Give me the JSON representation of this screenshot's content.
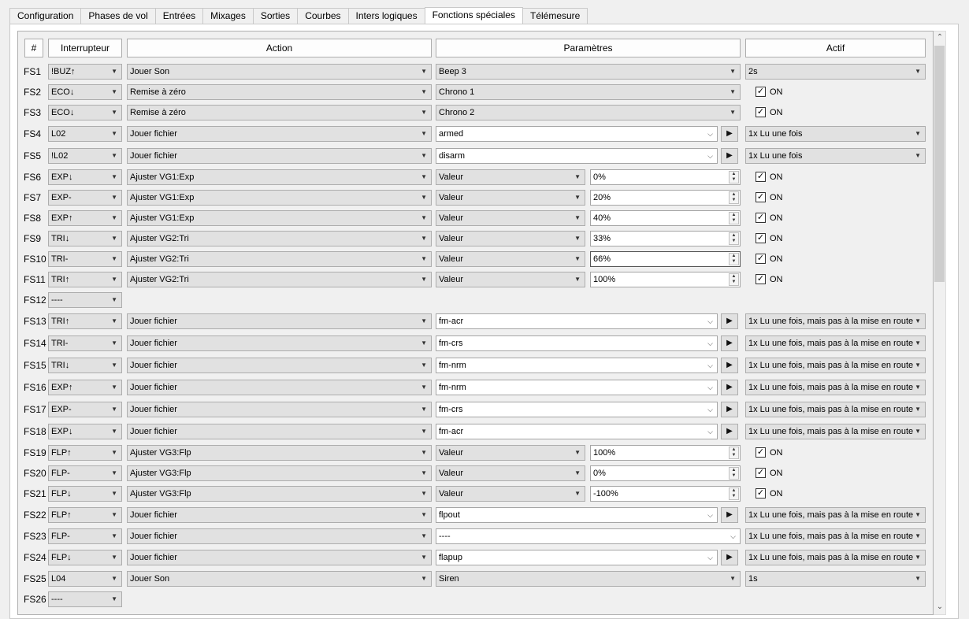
{
  "tabs": [
    "Configuration",
    "Phases de vol",
    "Entrées",
    "Mixages",
    "Sorties",
    "Courbes",
    "Inters logiques",
    "Fonctions spéciales",
    "Télémesure"
  ],
  "active_tab": "Fonctions spéciales",
  "headers": {
    "num": "#",
    "switch": "Interrupteur",
    "action": "Action",
    "params": "Paramètres",
    "active": "Actif"
  },
  "on_label": "ON",
  "rows": [
    {
      "id": "FS1",
      "sw": "!BUZ↑",
      "action": "Jouer Son",
      "kind": "combo",
      "param": "Beep 3",
      "active_type": "combo",
      "active": "2s"
    },
    {
      "id": "FS2",
      "sw": "ECO↓",
      "action": "Remise à zéro",
      "kind": "combo",
      "param": "Chrono 1",
      "active_type": "check",
      "checked": true
    },
    {
      "id": "FS3",
      "sw": "ECO↓",
      "action": "Remise à zéro",
      "kind": "combo",
      "param": "Chrono 2",
      "active_type": "check",
      "checked": true
    },
    {
      "id": "FS4",
      "sw": "L02",
      "action": "Jouer fichier",
      "kind": "file",
      "param": "armed",
      "play": true,
      "active_type": "combo",
      "active": "1x Lu une fois"
    },
    {
      "id": "FS5",
      "sw": "!L02",
      "action": "Jouer fichier",
      "kind": "file",
      "param": "disarm",
      "play": true,
      "active_type": "combo",
      "active": "1x Lu une fois"
    },
    {
      "id": "FS6",
      "sw": "EXP↓",
      "action": "Ajuster VG1:Exp",
      "kind": "value",
      "param": "Valeur",
      "value": "0%",
      "active_type": "check",
      "checked": true
    },
    {
      "id": "FS7",
      "sw": "EXP-",
      "action": "Ajuster VG1:Exp",
      "kind": "value",
      "param": "Valeur",
      "value": "20%",
      "active_type": "check",
      "checked": true
    },
    {
      "id": "FS8",
      "sw": "EXP↑",
      "action": "Ajuster VG1:Exp",
      "kind": "value",
      "param": "Valeur",
      "value": "40%",
      "active_type": "check",
      "checked": true
    },
    {
      "id": "FS9",
      "sw": "TRI↓",
      "action": "Ajuster VG2:Tri",
      "kind": "value",
      "param": "Valeur",
      "value": "33%",
      "active_type": "check",
      "checked": true
    },
    {
      "id": "FS10",
      "sw": "TRI-",
      "action": "Ajuster VG2:Tri",
      "kind": "value",
      "param": "Valeur",
      "value": "66%",
      "focus": true,
      "active_type": "check",
      "checked": true
    },
    {
      "id": "FS11",
      "sw": "TRI↑",
      "action": "Ajuster VG2:Tri",
      "kind": "value",
      "param": "Valeur",
      "value": "100%",
      "active_type": "check",
      "checked": true
    },
    {
      "id": "FS12",
      "sw": "----",
      "kind": "empty"
    },
    {
      "id": "FS13",
      "sw": "TRI↑",
      "action": "Jouer fichier",
      "kind": "file",
      "param": "fm-acr",
      "play": true,
      "active_type": "combo",
      "active": "1x Lu une fois, mais pas à la mise en route"
    },
    {
      "id": "FS14",
      "sw": "TRI-",
      "action": "Jouer fichier",
      "kind": "file",
      "param": "fm-crs",
      "play": true,
      "active_type": "combo",
      "active": "1x Lu une fois, mais pas à la mise en route"
    },
    {
      "id": "FS15",
      "sw": "TRI↓",
      "action": "Jouer fichier",
      "kind": "file",
      "param": "fm-nrm",
      "play": true,
      "active_type": "combo",
      "active": "1x Lu une fois, mais pas à la mise en route"
    },
    {
      "id": "FS16",
      "sw": "EXP↑",
      "action": "Jouer fichier",
      "kind": "file",
      "param": "fm-nrm",
      "play": true,
      "active_type": "combo",
      "active": "1x Lu une fois, mais pas à la mise en route"
    },
    {
      "id": "FS17",
      "sw": "EXP-",
      "action": "Jouer fichier",
      "kind": "file",
      "param": "fm-crs",
      "play": true,
      "active_type": "combo",
      "active": "1x Lu une fois, mais pas à la mise en route"
    },
    {
      "id": "FS18",
      "sw": "EXP↓",
      "action": "Jouer fichier",
      "kind": "file",
      "param": "fm-acr",
      "play": true,
      "active_type": "combo",
      "active": "1x Lu une fois, mais pas à la mise en route"
    },
    {
      "id": "FS19",
      "sw": "FLP↑",
      "action": "Ajuster VG3:Flp",
      "kind": "value",
      "param": "Valeur",
      "value": "100%",
      "active_type": "check",
      "checked": true
    },
    {
      "id": "FS20",
      "sw": "FLP-",
      "action": "Ajuster VG3:Flp",
      "kind": "value",
      "param": "Valeur",
      "value": "0%",
      "active_type": "check",
      "checked": true
    },
    {
      "id": "FS21",
      "sw": "FLP↓",
      "action": "Ajuster VG3:Flp",
      "kind": "value",
      "param": "Valeur",
      "value": "-100%",
      "active_type": "check",
      "checked": true
    },
    {
      "id": "FS22",
      "sw": "FLP↑",
      "action": "Jouer fichier",
      "kind": "file",
      "param": "flpout",
      "play": true,
      "active_type": "combo",
      "active": "1x Lu une fois, mais pas à la mise en route"
    },
    {
      "id": "FS23",
      "sw": "FLP-",
      "action": "Jouer fichier",
      "kind": "file",
      "param": "----",
      "play": false,
      "active_type": "combo",
      "active": "1x Lu une fois, mais pas à la mise en route"
    },
    {
      "id": "FS24",
      "sw": "FLP↓",
      "action": "Jouer fichier",
      "kind": "file",
      "param": "flapup",
      "play": true,
      "active_type": "combo",
      "active": "1x Lu une fois, mais pas à la mise en route"
    },
    {
      "id": "FS25",
      "sw": "L04",
      "action": "Jouer Son",
      "kind": "combo",
      "param": "Siren",
      "active_type": "combo",
      "active": "1s"
    },
    {
      "id": "FS26",
      "sw": "----",
      "kind": "empty"
    }
  ]
}
